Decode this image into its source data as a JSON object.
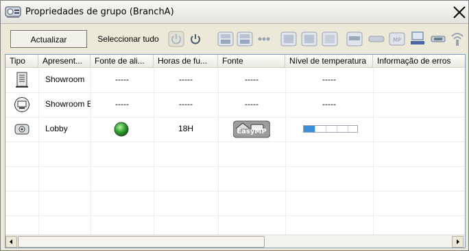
{
  "window": {
    "title": "Propriedades de grupo (BranchA)"
  },
  "toolbar": {
    "refresh_label": "Actualizar",
    "select_all_label": "Seleccionar tudo",
    "icons": [
      "power-off-icon",
      "power-on-icon",
      "computer1-icon",
      "computer2-icon",
      "video-icon",
      "s-video-icon",
      "component-icon",
      "hdmi-icon",
      "dvi-icon",
      "usb-icon",
      "easymp-icon",
      "lan-icon",
      "network-icon",
      "wireless-icon"
    ]
  },
  "table": {
    "columns": [
      "Tipo",
      "Apresent...",
      "Fonte de ali...",
      "Horas de fu...",
      "Fonte",
      "Nível de temperatura",
      "Informação de erros"
    ],
    "rows": [
      {
        "type_icon": "tower-projector-icon",
        "name": "Showroom",
        "power": "-----",
        "hours": "-----",
        "source": "-----",
        "temperature": "-----",
        "errors": ""
      },
      {
        "type_icon": "round-projector-icon",
        "name": "Showroom E",
        "power": "-----",
        "hours": "-----",
        "source": "-----",
        "temperature": "-----",
        "errors": ""
      },
      {
        "type_icon": "compact-projector-icon",
        "name": "Lobby",
        "power": "green-on-indicator",
        "hours": "18H",
        "source": "EasyMP",
        "temperature_level": 0.2,
        "errors": ""
      }
    ]
  },
  "colors": {
    "power_on": "#2fa52f",
    "temperature_fill": "#3a8fd8",
    "list_border": "#7f9db9"
  }
}
